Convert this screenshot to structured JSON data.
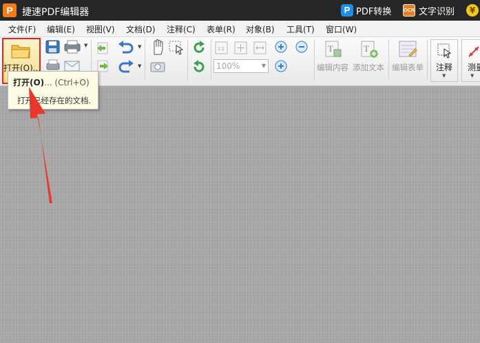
{
  "app": {
    "logo_letter": "P",
    "title": "捷速PDF编辑器",
    "pdf_convert_icon": "P",
    "pdf_convert_label": "PDF转换",
    "ocr_icon": "OCR",
    "ocr_label": "文字识别",
    "coin_icon": "¥"
  },
  "menu": [
    "文件(F)",
    "编辑(E)",
    "视图(V)",
    "文档(D)",
    "注释(C)",
    "表单(R)",
    "对象(B)",
    "工具(T)",
    "窗口(W)"
  ],
  "toolbar": {
    "open_label": "打开(O)...",
    "zoom_value": "100%",
    "edit_content_label": "编辑内容",
    "add_text_label": "添加文本",
    "edit_form_label": "编辑表单",
    "annotate_label": "注释",
    "measure_label": "测量"
  },
  "tooltip": {
    "title": "打开(O)",
    "shortcut": "... (Ctrl+O)",
    "description": "打开已经存在的文档."
  },
  "colors": {
    "titlebar": "#262626",
    "highlight": "#e2281e",
    "accent_orange": "#f07d1a",
    "accent_blue": "#1e8fe6"
  },
  "icons": [
    "folder-icon",
    "save-icon",
    "print-icon",
    "email-icon",
    "undo-icon",
    "redo-icon",
    "hand-icon",
    "select-icon",
    "rotate-icon",
    "fit-page-icon",
    "zoom-in-icon",
    "zoom-out-icon",
    "edit-content-icon",
    "add-text-icon",
    "edit-form-icon",
    "annotate-icon",
    "measure-icon"
  ]
}
